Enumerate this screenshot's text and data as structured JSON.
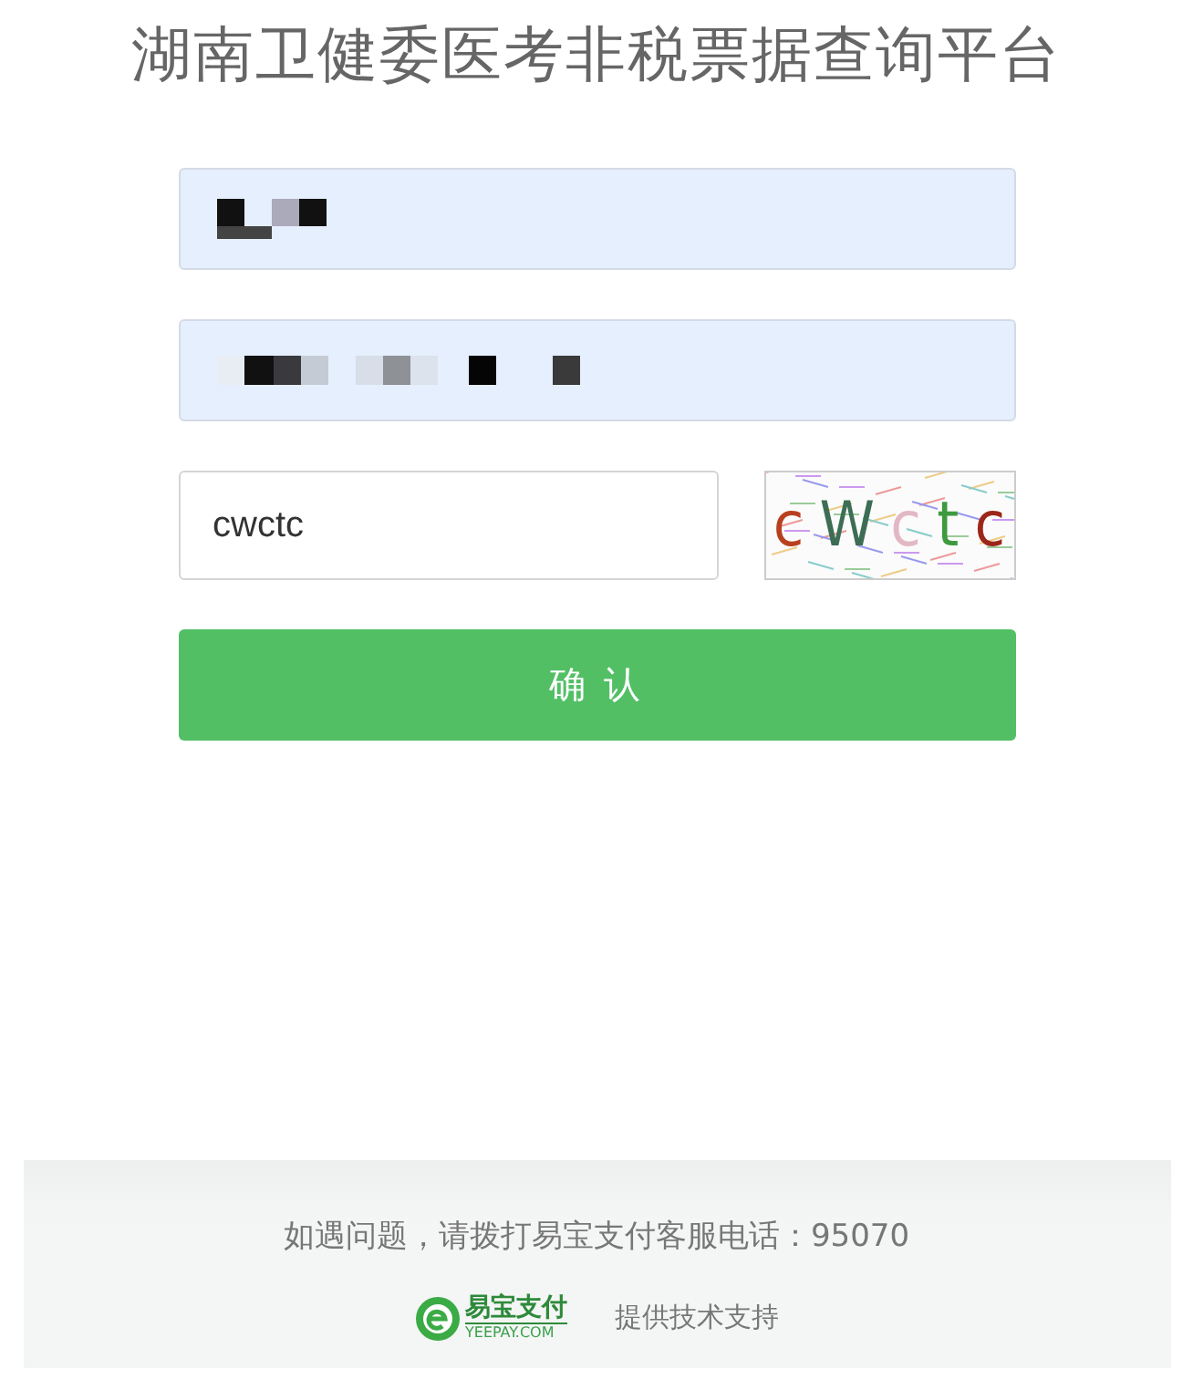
{
  "title": "湖南卫健委医考非税票据查询平台",
  "fields": [
    {
      "kind": "redacted"
    },
    {
      "kind": "redacted"
    }
  ],
  "captcha_field": {
    "value": "cwctc"
  },
  "captcha_image": {
    "characters": [
      {
        "char": "c",
        "color": "#b8401f"
      },
      {
        "char": "W",
        "color": "#3d6e55"
      },
      {
        "char": "c",
        "color": "#e2b8c4"
      },
      {
        "char": "t",
        "color": "#3e9a3e"
      },
      {
        "char": "c",
        "color": "#9c2618"
      }
    ]
  },
  "confirm_button": {
    "label": "确 认"
  },
  "footer": {
    "help": "如遇问题，请拨打易宝支付客服电话：95070",
    "logo_name": "易宝支付",
    "logo_domain": "YEEPAY.COM",
    "support": "提供技术支持"
  }
}
